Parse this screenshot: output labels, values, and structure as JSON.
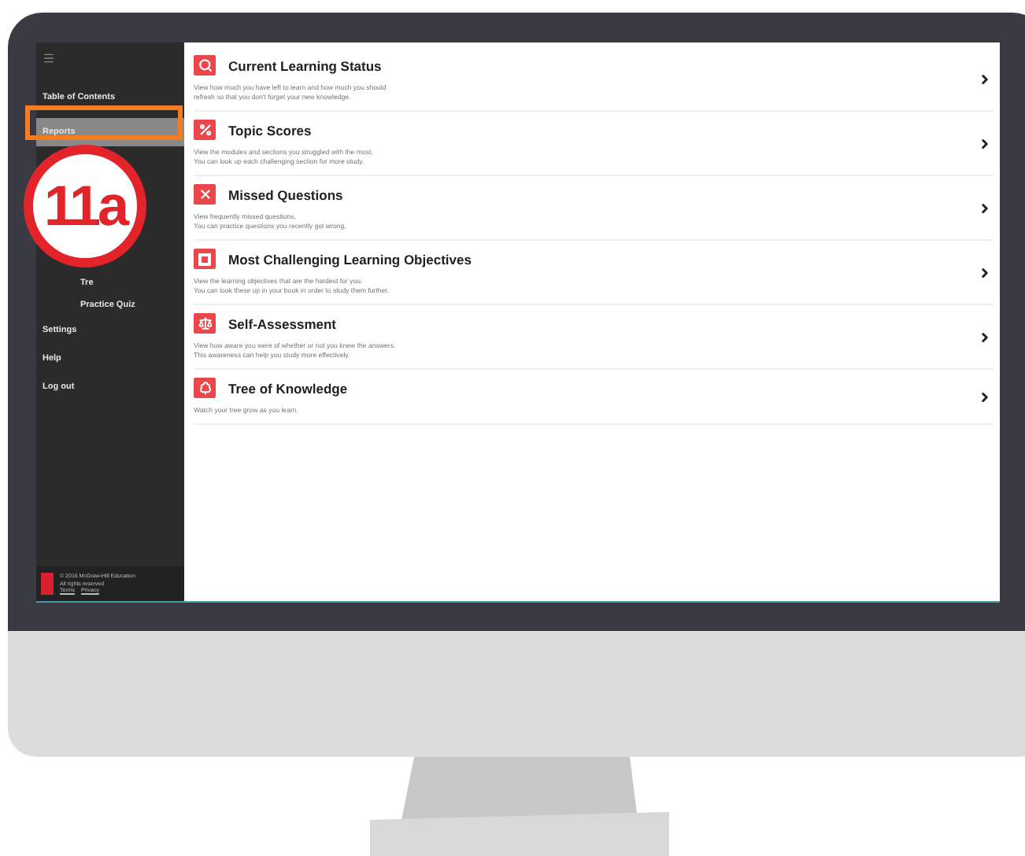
{
  "sidebar": {
    "items": [
      {
        "label": "Table of Contents",
        "kind": "top",
        "selected": false
      },
      {
        "label": "Reports",
        "kind": "top",
        "selected": true
      },
      {
        "label": "Tre",
        "kind": "sub",
        "selected": false
      },
      {
        "label": "Practice Quiz",
        "kind": "sub",
        "selected": false
      },
      {
        "label": "Settings",
        "kind": "top",
        "selected": false
      },
      {
        "label": "Help",
        "kind": "top",
        "selected": false
      },
      {
        "label": "Log out",
        "kind": "top",
        "selected": false
      }
    ],
    "footer": {
      "copyright": "© 2016 McGraw-Hill Education",
      "rights": "All rights reserved",
      "links": [
        "Terms",
        "Privacy"
      ]
    }
  },
  "callout": {
    "label": "11a"
  },
  "reports": [
    {
      "kind": "search",
      "title": "Current Learning Status",
      "description": "View how much you have left to learn and how much you should\nrefresh so that you don't forget your new knowledge."
    },
    {
      "kind": "percent",
      "title": "Topic Scores",
      "description": "View the modules and sections you struggled with the most.\nYou can look up each challenging section for more study."
    },
    {
      "kind": "cross",
      "title": "Missed Questions",
      "description": "View frequently missed questions.\nYou can practice questions you recently got wrong."
    },
    {
      "kind": "square",
      "title": "Most Challenging Learning Objectives",
      "description": "View the learning objectives that are the hardest for you.\nYou can look these up in your book in order to study them further."
    },
    {
      "kind": "scale",
      "title": "Self-Assessment",
      "description": "View how aware you were of whether or not you knew the answers.\nThis awareness can help you study more effectively."
    },
    {
      "kind": "tree",
      "title": "Tree of Knowledge",
      "description": "Watch your tree grow as you learn."
    }
  ]
}
